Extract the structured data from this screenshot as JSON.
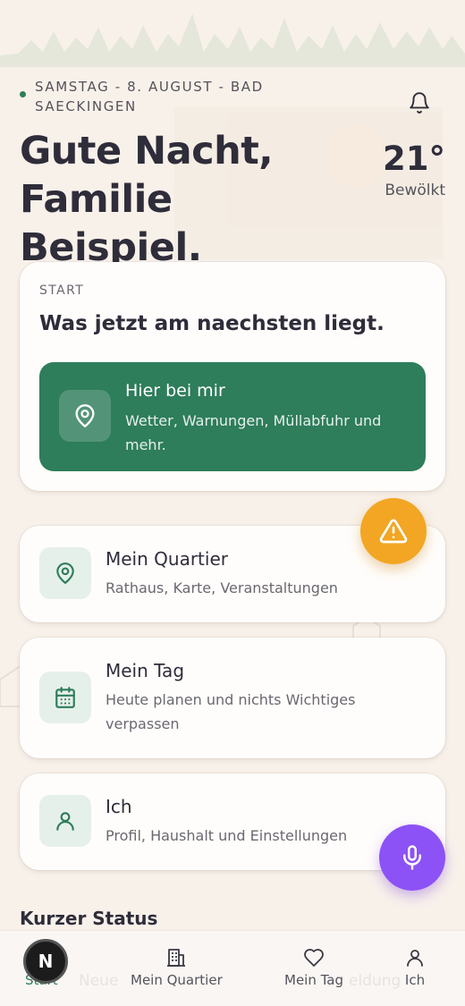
{
  "header": {
    "date_location": "SAMSTAG - 8. AUGUST - BAD SAECKINGEN",
    "greeting_line1": "Gute Nacht,",
    "greeting_line2": "Familie Beispiel.",
    "temperature": "21°",
    "condition": "Bewölkt"
  },
  "start_card": {
    "eyebrow": "START",
    "title": "Was jetzt am naechsten liegt.",
    "primary": {
      "title": "Hier bei mir",
      "subtitle": "Wetter, Warnungen, Müllabfuhr und mehr.",
      "icon": "location-pin-icon"
    }
  },
  "nav_cards": [
    {
      "title": "Mein Quartier",
      "subtitle": "Rathaus, Karte, Veranstaltungen",
      "icon": "location-pin-icon"
    },
    {
      "title": "Mein Tag",
      "subtitle": "Heute planen und nichts Wichtiges verpassen",
      "icon": "calendar-icon"
    },
    {
      "title": "Ich",
      "subtitle": "Profil, Haushalt und Einstellungen",
      "icon": "user-icon"
    }
  ],
  "status": {
    "title": "Kurzer Status",
    "ghost_left": "Neue",
    "ghost_right": "eldung"
  },
  "tabbar": {
    "tabs": [
      {
        "label": "Start",
        "icon": "home-icon",
        "active": true
      },
      {
        "label": "Mein Quartier",
        "icon": "building-icon"
      },
      {
        "label": "Mein Tag",
        "icon": "heart-icon"
      },
      {
        "label": "Ich",
        "icon": "user-icon"
      }
    ]
  },
  "fabs": {
    "warning": "warning-icon",
    "microphone": "microphone-icon"
  },
  "avatar": {
    "letter": "N"
  },
  "colors": {
    "background": "#f8f1ea",
    "primary_green": "#2e7d5b",
    "warning_orange": "#f2a623",
    "mic_purple": "#8c52f5",
    "text_dark": "#2f2d3a"
  }
}
